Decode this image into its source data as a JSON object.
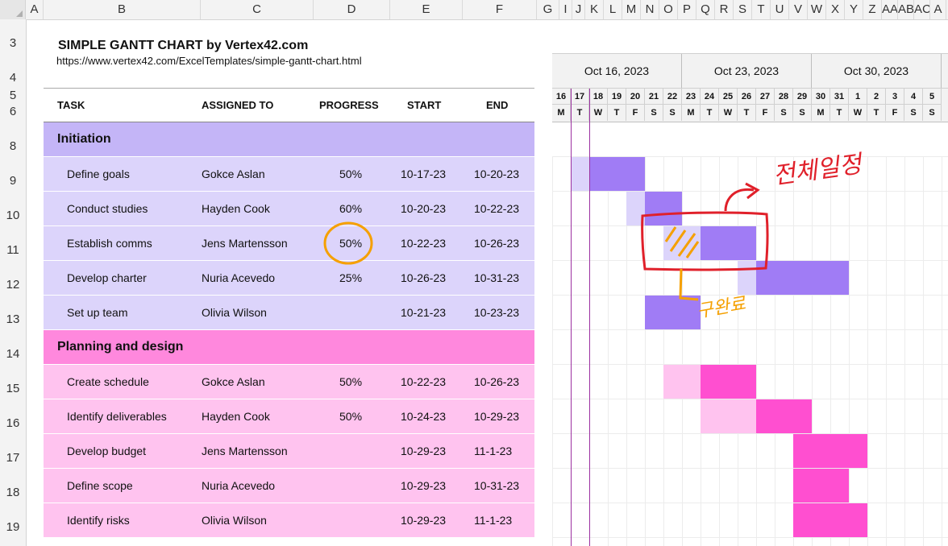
{
  "columns": [
    "A",
    "B",
    "C",
    "D",
    "E",
    "F",
    "G",
    "I",
    "J",
    "K",
    "L",
    "M",
    "N",
    "O",
    "P",
    "Q",
    "R",
    "S",
    "T",
    "U",
    "V",
    "W",
    "X",
    "Y",
    "Z",
    "AA",
    "AB",
    "AC",
    "A"
  ],
  "rows": [
    "3",
    "4",
    "5",
    "6",
    "8",
    "9",
    "10",
    "11",
    "12",
    "13",
    "14",
    "15",
    "16",
    "17",
    "18",
    "19"
  ],
  "title": "SIMPLE GANTT CHART by Vertex42.com",
  "url": "https://www.vertex42.com/ExcelTemplates/simple-gantt-chart.html",
  "headers": {
    "task": "TASK",
    "assigned": "ASSIGNED TO",
    "progress": "PROGRESS",
    "start": "START",
    "end": "END"
  },
  "groups": [
    {
      "name": "Initiation",
      "band": "#c4b5f7",
      "row_color": "#dcd4fb",
      "bar_done": "#a07cf5",
      "bar_rest": "#dcd4fb",
      "tasks": [
        {
          "task": "Define goals",
          "assigned": "Gokce Aslan",
          "progress": "50%",
          "start": "10-17-23",
          "end": "10-20-23"
        },
        {
          "task": "Conduct studies",
          "assigned": "Hayden Cook",
          "progress": "60%",
          "start": "10-20-23",
          "end": "10-22-23"
        },
        {
          "task": "Establish comms",
          "assigned": "Jens Martensson",
          "progress": "50%",
          "start": "10-22-23",
          "end": "10-26-23"
        },
        {
          "task": "Develop charter",
          "assigned": "Nuria Acevedo",
          "progress": "25%",
          "start": "10-26-23",
          "end": "10-31-23"
        },
        {
          "task": "Set up team",
          "assigned": "Olivia Wilson",
          "progress": "",
          "start": "10-21-23",
          "end": "10-23-23"
        }
      ]
    },
    {
      "name": "Planning and design",
      "band": "#ff88dd",
      "row_color": "#ffc3ef",
      "bar_done": "#ff4fd0",
      "bar_rest": "#ffc3ef",
      "tasks": [
        {
          "task": "Create schedule",
          "assigned": "Gokce Aslan",
          "progress": "50%",
          "start": "10-22-23",
          "end": "10-26-23"
        },
        {
          "task": "Identify deliverables",
          "assigned": "Hayden Cook",
          "progress": "50%",
          "start": "10-24-23",
          "end": "10-29-23"
        },
        {
          "task": "Develop budget",
          "assigned": "Jens Martensson",
          "progress": "",
          "start": "10-29-23",
          "end": "11-1-23"
        },
        {
          "task": "Define scope",
          "assigned": "Nuria Acevedo",
          "progress": "",
          "start": "10-29-23",
          "end": "10-31-23"
        },
        {
          "task": "Identify risks",
          "assigned": "Olivia Wilson",
          "progress": "",
          "start": "10-29-23",
          "end": "11-1-23"
        }
      ]
    }
  ],
  "weeks": [
    "Oct 16, 2023",
    "Oct 23, 2023",
    "Oct 30, 2023"
  ],
  "day_numbers": [
    "16",
    "17",
    "18",
    "19",
    "20",
    "21",
    "22",
    "23",
    "24",
    "25",
    "26",
    "27",
    "28",
    "29",
    "30",
    "31",
    "1",
    "2",
    "3",
    "4",
    "5"
  ],
  "day_letters": [
    "M",
    "T",
    "W",
    "T",
    "F",
    "S",
    "S",
    "M",
    "T",
    "W",
    "T",
    "F",
    "S",
    "S",
    "M",
    "T",
    "W",
    "T",
    "F",
    "S",
    "S"
  ],
  "gantt_bars": [
    {
      "row": 0,
      "done_start": "10-18-23",
      "done_end": "10-20-23",
      "rest_start": "10-17-23",
      "rest_end": "10-18-23"
    },
    {
      "row": 1,
      "done_start": "10-21-23",
      "done_end": "10-22-23",
      "rest_start": "10-20-23",
      "rest_end": "10-20-23"
    },
    {
      "row": 2,
      "done_start": "10-24-23",
      "done_end": "10-26-23",
      "rest_start": "10-22-23",
      "rest_end": "10-23-23"
    },
    {
      "row": 3,
      "done_start": "10-27-23",
      "done_end": "10-31-23",
      "rest_start": "10-26-23",
      "rest_end": "10-26-23"
    },
    {
      "row": 4,
      "done_start": "10-21-23",
      "done_end": "10-23-23",
      "rest_start": "",
      "rest_end": ""
    },
    {
      "row": 6,
      "done_start": "10-24-23",
      "done_end": "10-26-23",
      "rest_start": "10-22-23",
      "rest_end": "10-23-23"
    },
    {
      "row": 7,
      "done_start": "10-27-23",
      "done_end": "10-29-23",
      "rest_start": "10-24-23",
      "rest_end": "10-26-23"
    },
    {
      "row": 8,
      "done_start": "10-29-23",
      "done_end": "11-1-23",
      "rest_start": "",
      "rest_end": ""
    },
    {
      "row": 9,
      "done_start": "10-29-23",
      "done_end": "10-31-23",
      "rest_start": "",
      "rest_end": ""
    },
    {
      "row": 10,
      "done_start": "10-29-23",
      "done_end": "11-1-23",
      "rest_start": "",
      "rest_end": ""
    }
  ],
  "annotations": {
    "red_note": "전체일정",
    "orange_note": "구완료"
  }
}
